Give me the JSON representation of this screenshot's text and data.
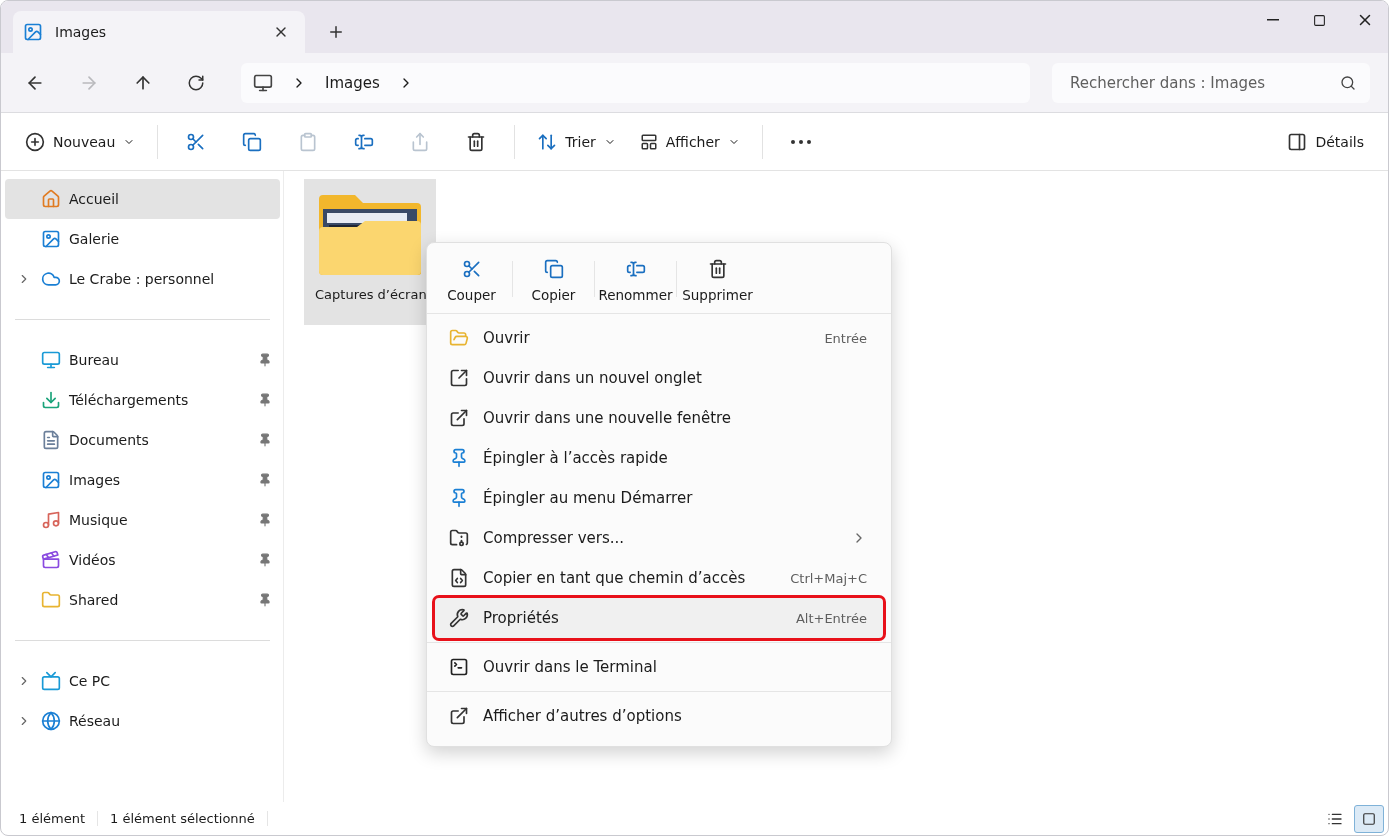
{
  "tabs": [
    {
      "label": "Images",
      "selected": true
    }
  ],
  "address": {
    "crumbs": [
      "Images"
    ]
  },
  "search": {
    "placeholder": "Rechercher dans : Images"
  },
  "toolbar": {
    "items": [
      {
        "kind": "new",
        "label": "Nouveau",
        "disabled": false
      },
      {
        "kind": "cut",
        "disabled": false
      },
      {
        "kind": "copy",
        "disabled": false
      },
      {
        "kind": "paste",
        "disabled": true
      },
      {
        "kind": "rename",
        "disabled": false
      },
      {
        "kind": "share",
        "disabled": true
      },
      {
        "kind": "delete",
        "disabled": false
      },
      {
        "kind": "sort",
        "label": "Trier",
        "disabled": false
      },
      {
        "kind": "view",
        "label": "Afficher",
        "disabled": false
      },
      {
        "kind": "more",
        "disabled": false
      }
    ],
    "details_label": "Détails"
  },
  "sidebar": {
    "groups": [
      {
        "items": [
          {
            "kind": "home",
            "label": "Accueil",
            "selected": true,
            "expandable": false,
            "pinned": false
          },
          {
            "kind": "gallery",
            "label": "Galerie",
            "selected": false,
            "expandable": false,
            "pinned": false
          },
          {
            "kind": "cloud",
            "label": "Le Crabe : personnel",
            "selected": false,
            "expandable": true,
            "pinned": false
          }
        ]
      },
      {
        "items": [
          {
            "kind": "desktop",
            "label": "Bureau",
            "selected": false,
            "expandable": false,
            "pinned": true
          },
          {
            "kind": "download",
            "label": "Téléchargements",
            "selected": false,
            "expandable": false,
            "pinned": true
          },
          {
            "kind": "documents",
            "label": "Documents",
            "selected": false,
            "expandable": false,
            "pinned": true
          },
          {
            "kind": "pictures",
            "label": "Images",
            "selected": false,
            "expandable": false,
            "pinned": true
          },
          {
            "kind": "music",
            "label": "Musique",
            "selected": false,
            "expandable": false,
            "pinned": true
          },
          {
            "kind": "videos",
            "label": "Vidéos",
            "selected": false,
            "expandable": false,
            "pinned": true
          },
          {
            "kind": "folder",
            "label": "Shared",
            "selected": false,
            "expandable": false,
            "pinned": true
          }
        ]
      },
      {
        "items": [
          {
            "kind": "pc",
            "label": "Ce PC",
            "selected": false,
            "expandable": true,
            "pinned": false
          },
          {
            "kind": "network",
            "label": "Réseau",
            "selected": false,
            "expandable": true,
            "pinned": false
          }
        ]
      }
    ]
  },
  "files": [
    {
      "name": "Captures d’écran",
      "selected": true
    }
  ],
  "context_menu": {
    "quick_actions": [
      {
        "kind": "cut",
        "label": "Couper"
      },
      {
        "kind": "copy",
        "label": "Copier"
      },
      {
        "kind": "rename",
        "label": "Renommer"
      },
      {
        "kind": "delete",
        "label": "Supprimer"
      }
    ],
    "sections": [
      {
        "items": [
          {
            "kind": "open",
            "label": "Ouvrir",
            "shortcut": "Entrée",
            "submenu": false,
            "highlighted": false
          },
          {
            "kind": "new-tab",
            "label": "Ouvrir dans un nouvel onglet",
            "submenu": false,
            "highlighted": false
          },
          {
            "kind": "new-window",
            "label": "Ouvrir dans une nouvelle fenêtre",
            "submenu": false,
            "highlighted": false
          },
          {
            "kind": "pin",
            "label": "Épingler à l’accès rapide",
            "submenu": false,
            "highlighted": false
          },
          {
            "kind": "pin-start",
            "label": "Épingler au menu Démarrer",
            "submenu": false,
            "highlighted": false
          },
          {
            "kind": "compress",
            "label": "Compresser vers...",
            "submenu": true,
            "highlighted": false
          },
          {
            "kind": "path",
            "label": "Copier en tant que chemin d’accès",
            "shortcut": "Ctrl+Maj+C",
            "submenu": false,
            "highlighted": false
          },
          {
            "kind": "properties",
            "label": "Propriétés",
            "shortcut": "Alt+Entrée",
            "submenu": false,
            "highlighted": true
          }
        ]
      },
      {
        "items": [
          {
            "kind": "terminal",
            "label": "Ouvrir dans le Terminal",
            "submenu": false,
            "highlighted": false
          }
        ]
      },
      {
        "items": [
          {
            "kind": "more",
            "label": "Afficher d’autres d’options",
            "submenu": false,
            "highlighted": false
          }
        ]
      }
    ]
  },
  "status_bar": {
    "texts": [
      "1 élément",
      "1 élément sélectionné"
    ],
    "view_buttons": [
      {
        "kind": "details",
        "selected": false
      },
      {
        "kind": "tiles",
        "selected": true
      }
    ]
  }
}
